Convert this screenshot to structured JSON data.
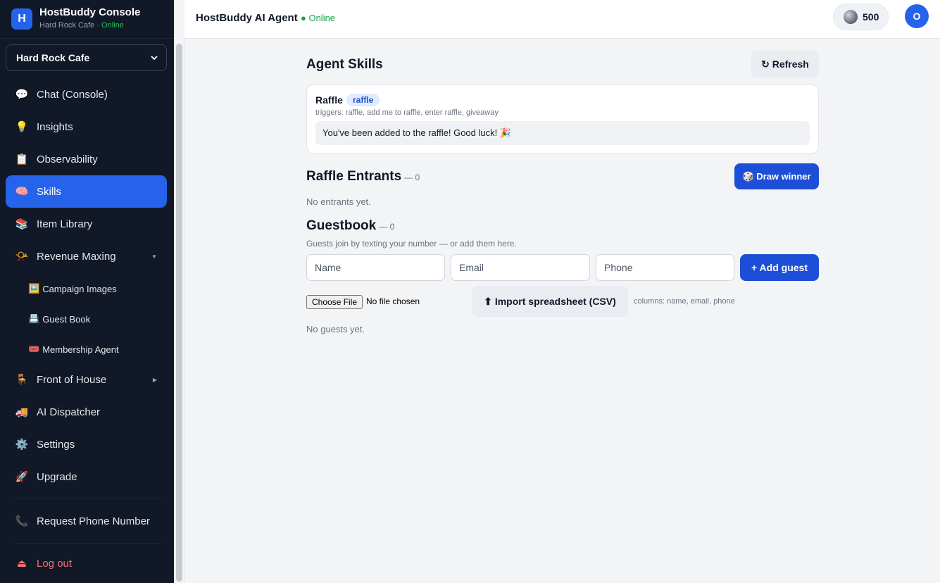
{
  "brand": {
    "logo_letter": "H",
    "title": "HostBuddy Console",
    "subtitle": "Hard Rock Cafe · ",
    "status": "Online"
  },
  "venue_select": {
    "value": "Hard Rock Cafe"
  },
  "sidebar": {
    "items": [
      {
        "label": "Chat (Console)",
        "icon": "💬"
      },
      {
        "label": "Insights",
        "icon": "💡"
      },
      {
        "label": "Observability",
        "icon": "📋"
      },
      {
        "label": "Skills",
        "icon": "🧠"
      },
      {
        "label": "Item Library",
        "icon": "📚"
      },
      {
        "label": "Revenue Maxing",
        "icon": "📯"
      },
      {
        "label": "Front of House",
        "icon": "🪑"
      },
      {
        "label": "AI Dispatcher",
        "icon": "🚚"
      },
      {
        "label": "Settings",
        "icon": "⚙️"
      },
      {
        "label": "Upgrade",
        "icon": "🚀"
      },
      {
        "label": "Request Phone Number",
        "icon": "📞"
      },
      {
        "label": "Log out",
        "icon": "⏏"
      }
    ],
    "sub_items": [
      {
        "label": "Campaign Images",
        "icon": "🖼️"
      },
      {
        "label": "Guest Book",
        "icon": "📇"
      },
      {
        "label": "Membership Agent",
        "icon": "🎟️"
      }
    ],
    "active": "Skills"
  },
  "header": {
    "title": "HostBuddy AI Agent",
    "status": "● Online",
    "credits": "500",
    "avatar_letter": "O"
  },
  "skills": {
    "heading": "Agent Skills",
    "refresh_label": "↻ Refresh",
    "card": {
      "name": "Raffle",
      "tag": "raffle",
      "triggers": "triggers: raffle, add me to raffle, enter raffle, giveaway",
      "response": "You've been added to the raffle! Good luck! 🎉"
    }
  },
  "raffle": {
    "heading": "Raffle Entrants",
    "count": "— 0",
    "draw_label": "🎲 Draw winner",
    "empty": "No entrants yet."
  },
  "guestbook": {
    "heading": "Guestbook",
    "count": "— 0",
    "description": "Guests join by texting your number — or add them here.",
    "name_placeholder": "Name",
    "email_placeholder": "Email",
    "phone_placeholder": "Phone",
    "add_label": "+ Add guest",
    "choose_file_label": "Choose File",
    "no_file_label": "No file chosen",
    "import_label": "⬆ Import spreadsheet (CSV)",
    "columns_hint": "columns: name, email, phone",
    "empty": "No guests yet."
  },
  "colors": {
    "sidebar_bg": "#111827",
    "accent": "#2563eb",
    "online": "#16a34a",
    "logout": "#f87171"
  }
}
